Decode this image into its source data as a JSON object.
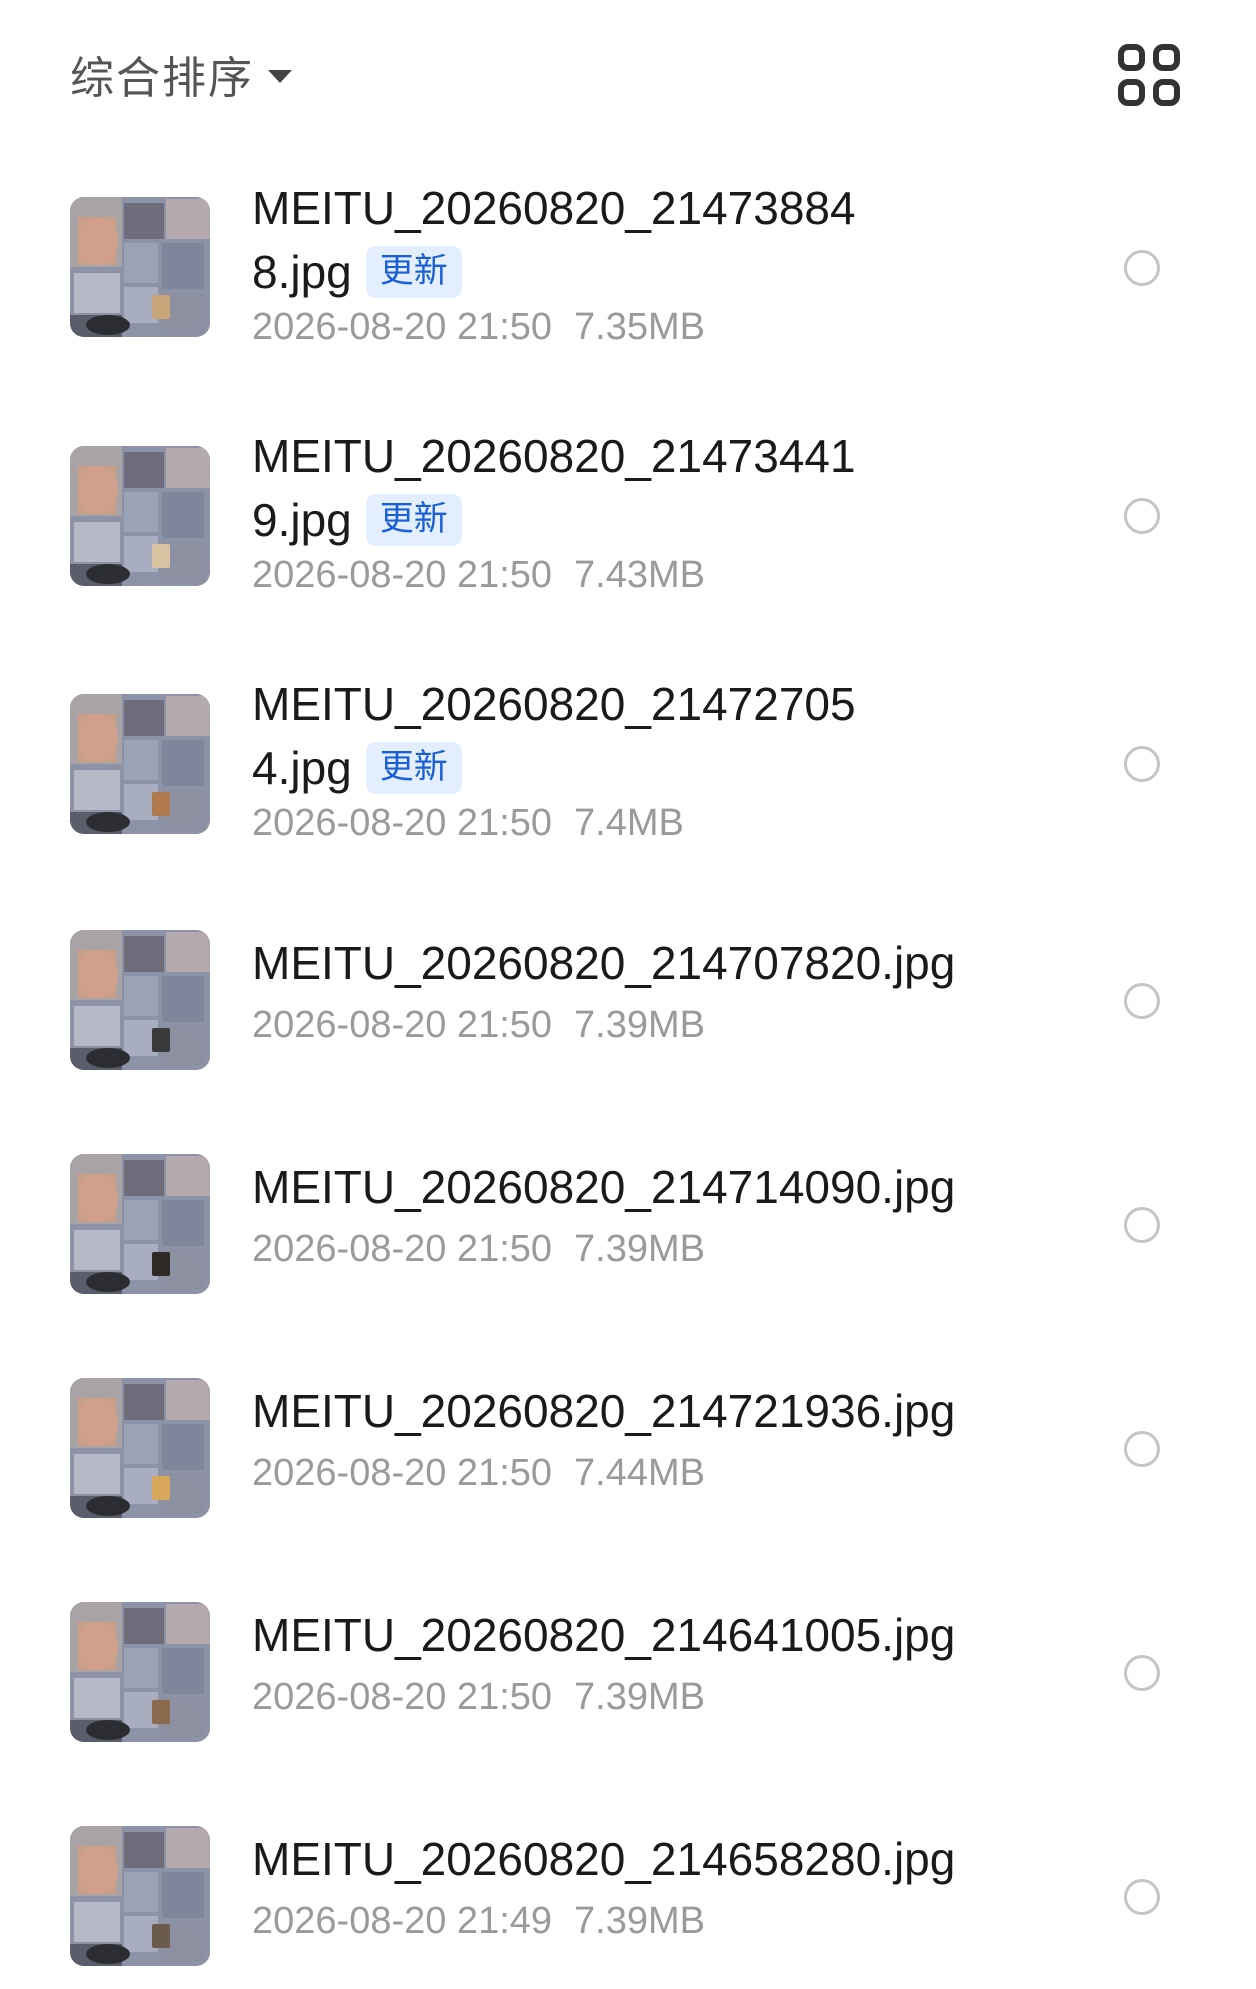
{
  "toolbar": {
    "sort_label": "综合排序",
    "sort_icon": "caret-down-icon",
    "view_toggle_icon": "grid-view-icon"
  },
  "files": [
    {
      "name_line1": "MEITU_20260820_21473884",
      "name_line2": "8.jpg",
      "badge": "更新",
      "date": "2026-08-20 21:50",
      "size": "7.35MB",
      "selected": false
    },
    {
      "name_line1": "MEITU_20260820_21473441",
      "name_line2": "9.jpg",
      "badge": "更新",
      "date": "2026-08-20 21:50",
      "size": "7.43MB",
      "selected": false
    },
    {
      "name_line1": "MEITU_20260820_21472705",
      "name_line2": "4.jpg",
      "badge": "更新",
      "date": "2026-08-20 21:50",
      "size": "7.4MB",
      "selected": false
    },
    {
      "name": "MEITU_20260820_214707820.jpg",
      "date": "2026-08-20 21:50",
      "size": "7.39MB",
      "selected": false
    },
    {
      "name": "MEITU_20260820_214714090.jpg",
      "date": "2026-08-20 21:50",
      "size": "7.39MB",
      "selected": false
    },
    {
      "name": "MEITU_20260820_214721936.jpg",
      "date": "2026-08-20 21:50",
      "size": "7.44MB",
      "selected": false
    },
    {
      "name": "MEITU_20260820_214641005.jpg",
      "date": "2026-08-20 21:50",
      "size": "7.39MB",
      "selected": false
    },
    {
      "name": "MEITU_20260820_214658280.jpg",
      "date": "2026-08-20 21:49",
      "size": "7.39MB",
      "selected": false
    }
  ],
  "colors": {
    "badge_bg": "#e3efff",
    "badge_text": "#1a5fd6",
    "meta_text": "#9a9a9a"
  }
}
